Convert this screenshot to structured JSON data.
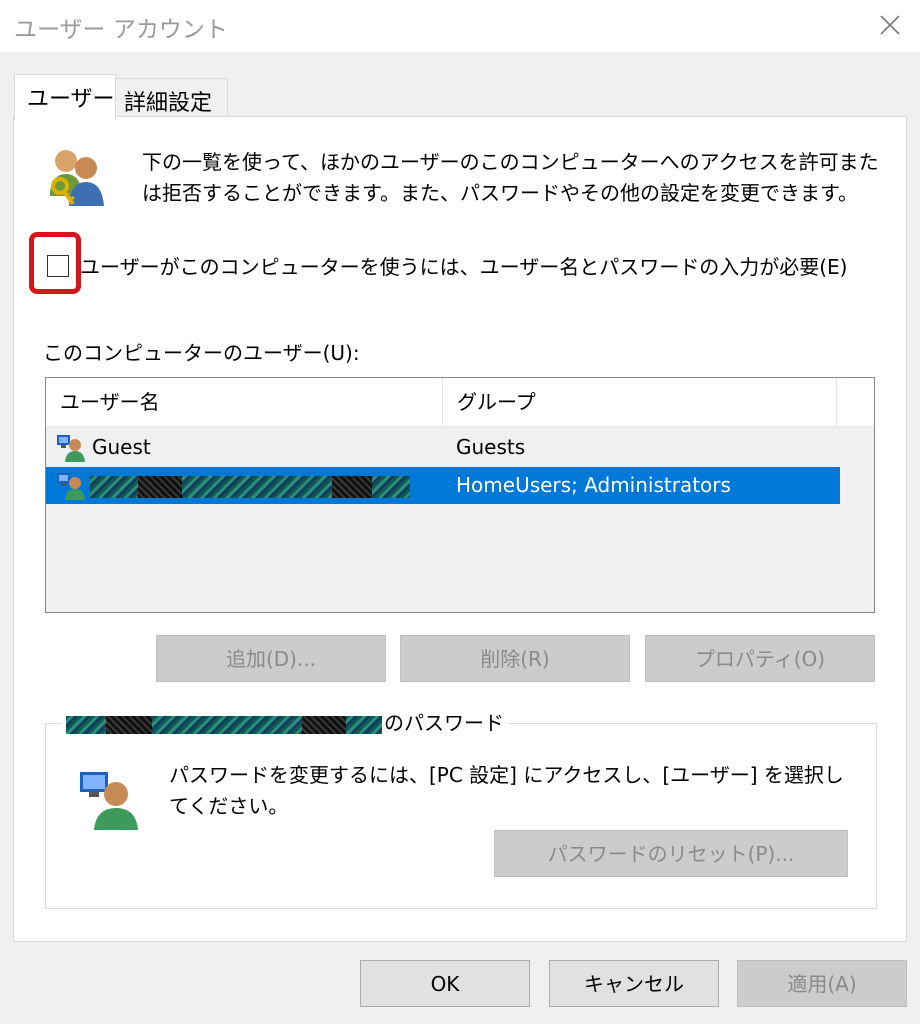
{
  "window": {
    "title": "ユーザー アカウント"
  },
  "tabs": [
    {
      "label": "ユーザー",
      "active": true
    },
    {
      "label": "詳細設定",
      "active": false
    }
  ],
  "intro": {
    "text": "下の一覧を使って、ほかのユーザーのこのコンピューターへのアクセスを許可または拒否することができます。また、パスワードやその他の設定を変更できます。"
  },
  "require_password": {
    "label": "ユーザーがこのコンピューターを使うには、ユーザー名とパスワードの入力が必要(E)",
    "checked": false,
    "highlight_color": "#d5161c"
  },
  "users_list": {
    "label": "このコンピューターのユーザー(U):",
    "columns": [
      "ユーザー名",
      "グループ"
    ],
    "rows": [
      {
        "name": "Guest",
        "group": "Guests",
        "selected": false
      },
      {
        "name": "",
        "group": "HomeUsers; Administrators",
        "selected": true,
        "redacted": true
      }
    ],
    "selection_color": "#0078d7"
  },
  "list_buttons": {
    "add": "追加(D)...",
    "remove": "削除(R)",
    "properties": "プロパティ(O)"
  },
  "password_group": {
    "legend_suffix": "のパスワード",
    "text": "パスワードを変更するには、[PC 設定] にアクセスし、[ユーザー] を選択してください。",
    "reset_button": "パスワードのリセット(P)..."
  },
  "dialog_buttons": {
    "ok": "OK",
    "cancel": "キャンセル",
    "apply": "適用(A)"
  }
}
